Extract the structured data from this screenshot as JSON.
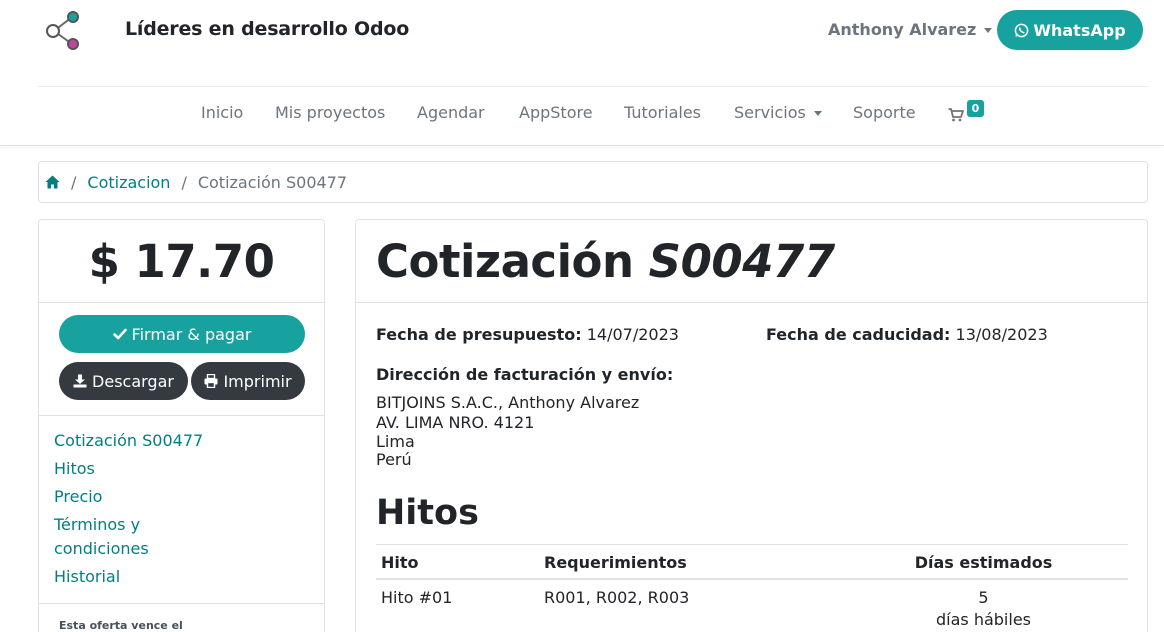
{
  "header": {
    "brand": "Líderes en desarrollo Odoo",
    "user_name": "Anthony Alvarez",
    "whatsapp_label": "WhatsApp",
    "nav": [
      "Inicio",
      "Mis proyectos",
      "Agendar",
      "AppStore",
      "Tutoriales",
      "Servicios",
      "Soporte"
    ],
    "cart_count": "0"
  },
  "breadcrumb": {
    "items": [
      "Cotizacion",
      "Cotización S00477"
    ]
  },
  "sidebar": {
    "price": "$ 17.70",
    "sign_pay_label": "Firmar & pagar",
    "download_label": "Descargar",
    "print_label": "Imprimir",
    "toc": [
      "Cotización S00477",
      "Hitos",
      "Precio",
      "Términos y condiciones",
      "Historial"
    ],
    "expire_note": "Esta oferta vence el"
  },
  "quote": {
    "title_prefix": "Cotización",
    "title_number": "S00477",
    "date_label": "Fecha de presupuesto:",
    "date_value": "14/07/2023",
    "expiry_label": "Fecha de caducidad:",
    "expiry_value": "13/08/2023",
    "address_title": "Dirección de facturación y envío:",
    "address_lines": [
      "BITJOINS S.A.C., Anthony Alvarez",
      "AV. LIMA NRO. 4121",
      "Lima",
      "Perú"
    ],
    "milestones_title": "Hitos",
    "table": {
      "headers": [
        "Hito",
        "Requerimientos",
        "Días estimados"
      ],
      "rows": [
        {
          "hito": "Hito #01",
          "req": "R001, R002, R003",
          "days": "5",
          "days_unit": "días hábiles"
        }
      ]
    }
  },
  "colors": {
    "accent": "#17a2a0",
    "link": "#017e84",
    "dark_button": "#343a40"
  }
}
